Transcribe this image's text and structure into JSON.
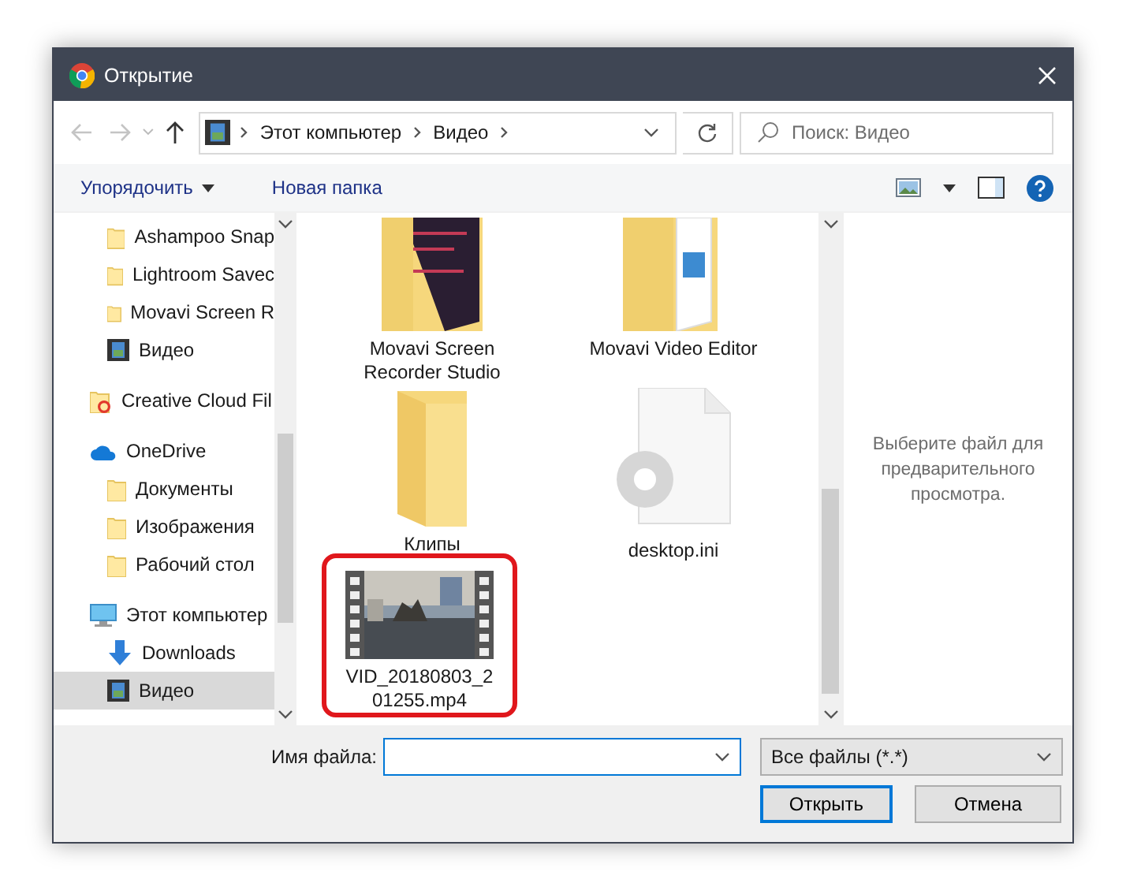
{
  "window": {
    "title": "Открытие"
  },
  "nav": {
    "back_disabled": true,
    "forward_disabled": true,
    "path": [
      "Этот компьютер",
      "Видео"
    ],
    "search": {
      "placeholder": "Поиск: Видео"
    }
  },
  "commands": {
    "organize": "Упорядочить",
    "new_folder": "Новая папка"
  },
  "sidebar": {
    "loose_items": [
      {
        "kind": "folder",
        "label": "Ashampoo Snap",
        "selected": false
      },
      {
        "kind": "folder",
        "label": "Lightroom Savec",
        "selected": false
      },
      {
        "kind": "folder",
        "label": "Movavi Screen R",
        "selected": false
      },
      {
        "kind": "video",
        "label": "Видео",
        "selected": false
      }
    ],
    "nodes": [
      {
        "kind": "cloud-folder",
        "label": "Creative Cloud Fil",
        "selected": false
      },
      {
        "kind": "onedrive",
        "label": "OneDrive",
        "selected": false,
        "children": [
          {
            "kind": "folder",
            "label": "Документы",
            "selected": false
          },
          {
            "kind": "folder",
            "label": "Изображения",
            "selected": false
          },
          {
            "kind": "folder",
            "label": "Рабочий стол",
            "selected": false
          }
        ]
      },
      {
        "kind": "computer",
        "label": "Этот компьютер",
        "selected": false,
        "children": [
          {
            "kind": "downloads",
            "label": "Downloads",
            "selected": false
          },
          {
            "kind": "video",
            "label": "Видео",
            "selected": true
          }
        ]
      }
    ]
  },
  "files": [
    {
      "kind": "folder-dark",
      "label": "Movavi Screen Recorder Studio",
      "highlighted": false
    },
    {
      "kind": "folder-doc",
      "label": "Movavi Video Editor",
      "highlighted": false
    },
    {
      "kind": "folder",
      "label": "Клипы",
      "highlighted": false
    },
    {
      "kind": "settings-file",
      "label": "desktop.ini",
      "highlighted": false
    },
    {
      "kind": "video",
      "label": "VID_20180803_201255.mp4",
      "highlighted": true
    }
  ],
  "preview": {
    "message": "Выберите файл для предварительного просмотра."
  },
  "footer": {
    "filename_label": "Имя файла:",
    "filter": "Все файлы (*.*)",
    "open": "Открыть",
    "cancel": "Отмена"
  }
}
